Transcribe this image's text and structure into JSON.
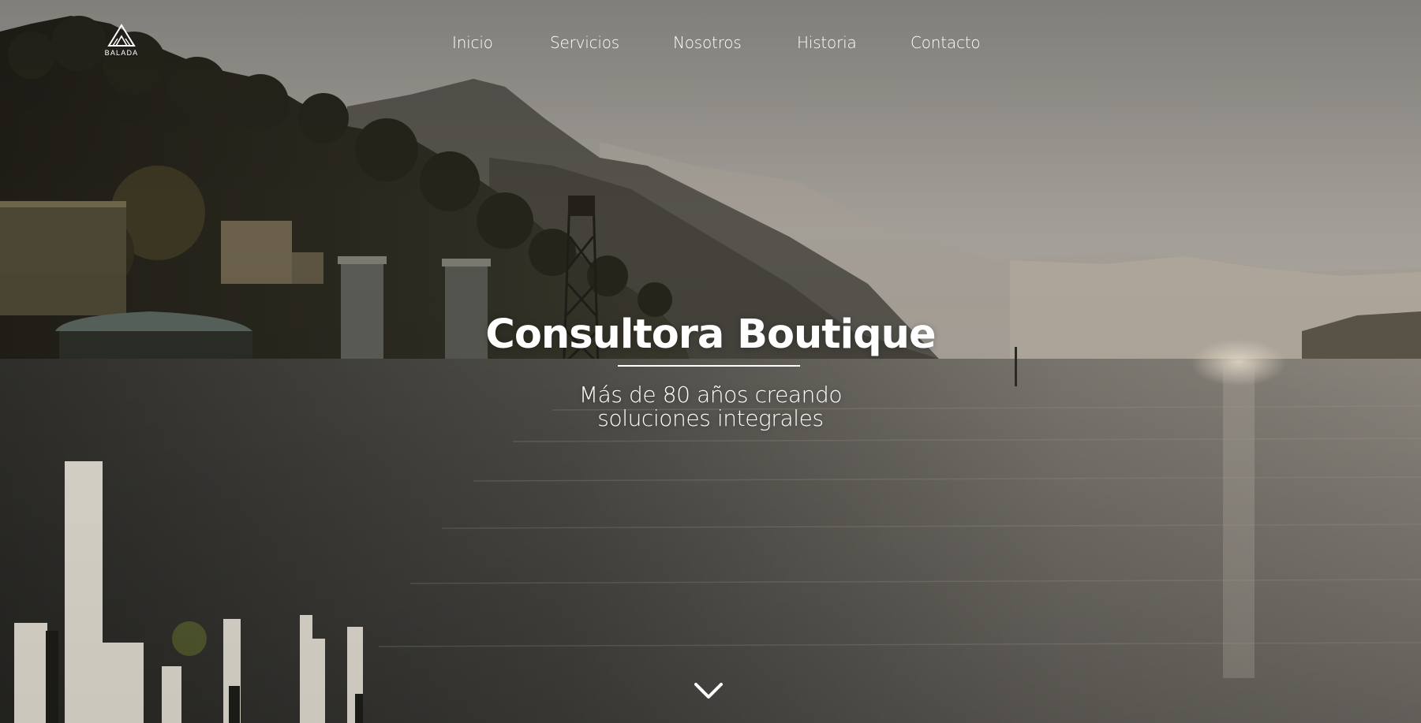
{
  "brand": {
    "name": "BALADA"
  },
  "nav": {
    "items": [
      {
        "label": "Inicio"
      },
      {
        "label": "Servicios"
      },
      {
        "label": "Nosotros"
      },
      {
        "label": "Historia"
      },
      {
        "label": "Contacto"
      }
    ]
  },
  "hero": {
    "title": "Consultora Boutique",
    "subtitle_line1": "Más de 80 años creando",
    "subtitle_line2": "soluciones integrales"
  },
  "icons": {
    "logo": "mountain-logo-icon",
    "scroll": "chevron-down-icon"
  },
  "colors": {
    "text": "#ffffff",
    "sky": "#9a9894",
    "water": "#6e6c66",
    "hills_dark": "#2c2a22"
  }
}
